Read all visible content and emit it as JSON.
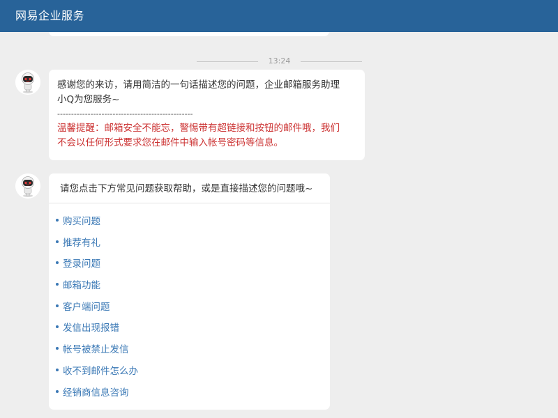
{
  "header": {
    "title": "网易企业服务"
  },
  "timestamp": "13:24",
  "messages": {
    "welcome": {
      "lines": [
        "感谢您的来访，请用简洁的一句话描述您的问题，企业邮箱服务助理",
        "小Q为您服务~"
      ],
      "divider": "-------------------------------------------------",
      "warning_lines": [
        "温馨提醒：邮箱安全不能忘，警惕带有超链接和按钮的邮件哦，我们",
        "不会以任何形式要求您在邮件中输入帐号密码等信息。"
      ]
    },
    "faq": {
      "prompt": "请您点击下方常见问题获取帮助，或是直接描述您的问题哦~",
      "items": [
        "购买问题",
        "推荐有礼",
        "登录问题",
        "邮箱功能",
        "客户端问题",
        "发信出现报错",
        "帐号被禁止发信",
        "收不到邮件怎么办",
        "经销商信息咨询"
      ]
    }
  },
  "colors": {
    "header_bg": "#286399",
    "link": "#3a78b5",
    "warning": "#cc3333",
    "background": "#eeeeee"
  },
  "icons": {
    "avatar": "robot-avatar-icon"
  }
}
